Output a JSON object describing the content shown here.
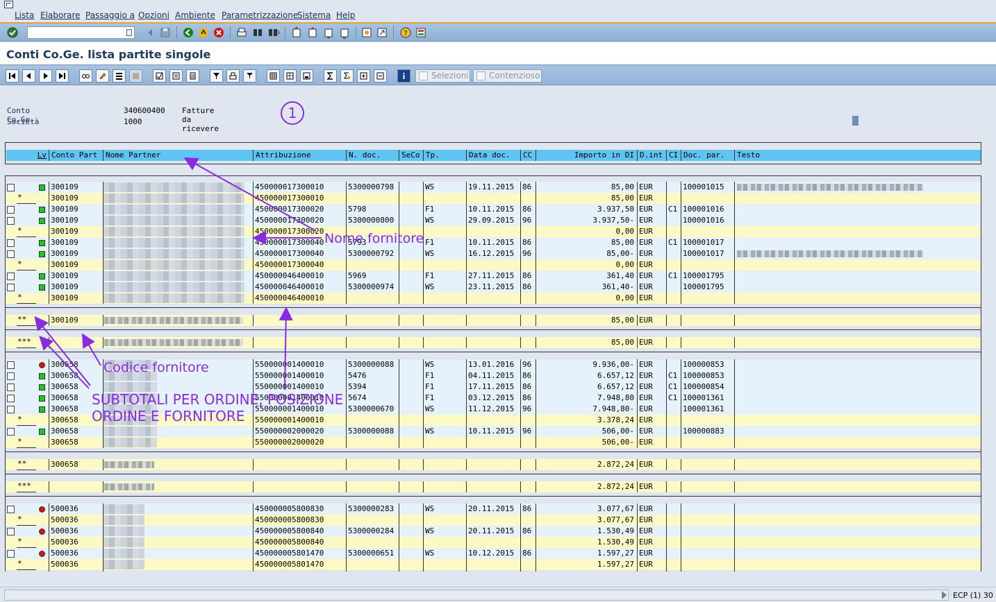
{
  "menu": [
    "Lista",
    "Elaborare",
    "Passaggio a",
    "Opzioni",
    "Ambiente",
    "Parametrizzazione",
    "Sistema",
    "Help"
  ],
  "command_field": "",
  "screen_title": "Conti Co.Ge. lista partite singole",
  "app_buttons": {
    "selezioni": "Selezioni",
    "contenzioso": "Contenzioso"
  },
  "header": {
    "conto_label": "Conto Co.Ge.",
    "conto_value": "340600400",
    "conto_desc": "Fatture da ricevere",
    "societa_label": "Società",
    "societa_value": "1000"
  },
  "marker": "1",
  "columns": [
    "Lv",
    "Conto Part",
    "Nome Partner",
    "Attribuzione",
    "N. doc.",
    "SeCo",
    "Tp.",
    "Data doc.",
    "CC",
    "Importo in DI",
    "D.int",
    "CI",
    "Doc. par.",
    "Testo"
  ],
  "rows": [
    {
      "cb": true,
      "lv": "",
      "led": "green",
      "conto": "300109",
      "partner": "",
      "attr": "450000017300010",
      "ndoc": "5300000798",
      "tp": "WS",
      "data": "19.11.2015",
      "cc": "86",
      "imp": "85,00",
      "div": "EUR",
      "ci": "",
      "docpar": "100001015",
      "testo": "",
      "kind": "w"
    },
    {
      "cb": false,
      "lv": "*",
      "led": "",
      "conto": "300109",
      "partner": "",
      "attr": "450000017300010",
      "ndoc": "",
      "tp": "",
      "data": "",
      "cc": "",
      "imp": "85,00",
      "div": "EUR",
      "ci": "",
      "docpar": "",
      "testo": "",
      "kind": "y"
    },
    {
      "cb": true,
      "lv": "",
      "led": "green",
      "conto": "300109",
      "partner": "",
      "attr": "450000017300020",
      "ndoc": "5798",
      "tp": "F1",
      "data": "10.11.2015",
      "cc": "86",
      "imp": "3.937,50",
      "div": "EUR",
      "ci": "C1",
      "docpar": "100001016",
      "testo": "",
      "kind": "w"
    },
    {
      "cb": true,
      "lv": "",
      "led": "green",
      "conto": "300109",
      "partner": "",
      "attr": "450000017300020",
      "ndoc": "5300000800",
      "tp": "WS",
      "data": "29.09.2015",
      "cc": "96",
      "imp": "3.937,50-",
      "div": "EUR",
      "ci": "",
      "docpar": "100001016",
      "testo": "",
      "kind": "w"
    },
    {
      "cb": false,
      "lv": "*",
      "led": "",
      "conto": "300109",
      "partner": "",
      "attr": "450000017300020",
      "ndoc": "",
      "tp": "",
      "data": "",
      "cc": "",
      "imp": "0,00",
      "div": "EUR",
      "ci": "",
      "docpar": "",
      "testo": "",
      "kind": "y"
    },
    {
      "cb": true,
      "lv": "",
      "led": "green",
      "conto": "300109",
      "partner": "",
      "attr": "450000017300040",
      "ndoc": "5793",
      "tp": "F1",
      "data": "10.11.2015",
      "cc": "86",
      "imp": "85,00",
      "div": "EUR",
      "ci": "C1",
      "docpar": "100001017",
      "testo": "",
      "kind": "w"
    },
    {
      "cb": true,
      "lv": "",
      "led": "green",
      "conto": "300109",
      "partner": "",
      "attr": "450000017300040",
      "ndoc": "5300000792",
      "tp": "WS",
      "data": "16.12.2015",
      "cc": "96",
      "imp": "85,00-",
      "div": "EUR",
      "ci": "",
      "docpar": "100001017",
      "testo": "",
      "kind": "w"
    },
    {
      "cb": false,
      "lv": "*",
      "led": "",
      "conto": "300109",
      "partner": "",
      "attr": "450000017300040",
      "ndoc": "",
      "tp": "",
      "data": "",
      "cc": "",
      "imp": "0,00",
      "div": "EUR",
      "ci": "",
      "docpar": "",
      "testo": "",
      "kind": "y"
    },
    {
      "cb": true,
      "lv": "",
      "led": "green",
      "conto": "300109",
      "partner": "",
      "attr": "450000046400010",
      "ndoc": "5969",
      "tp": "F1",
      "data": "27.11.2015",
      "cc": "86",
      "imp": "361,40",
      "div": "EUR",
      "ci": "C1",
      "docpar": "100001795",
      "testo": "",
      "kind": "w"
    },
    {
      "cb": true,
      "lv": "",
      "led": "green",
      "conto": "300109",
      "partner": "",
      "attr": "450000046400010",
      "ndoc": "5300000974",
      "tp": "WS",
      "data": "23.11.2015",
      "cc": "86",
      "imp": "361,40-",
      "div": "EUR",
      "ci": "",
      "docpar": "100001795",
      "testo": "",
      "kind": "w"
    },
    {
      "cb": false,
      "lv": "*",
      "led": "",
      "conto": "300109",
      "partner": "",
      "attr": "450000046400010",
      "ndoc": "",
      "tp": "",
      "data": "",
      "cc": "",
      "imp": "0,00",
      "div": "EUR",
      "ci": "",
      "docpar": "",
      "testo": "",
      "kind": "y"
    },
    {
      "kind": "gap"
    },
    {
      "cb": false,
      "lv": "**",
      "led": "",
      "conto": "300109",
      "partner": "",
      "attr": "",
      "ndoc": "",
      "tp": "",
      "data": "",
      "cc": "",
      "imp": "85,00",
      "div": "EUR",
      "ci": "",
      "docpar": "",
      "testo": "",
      "kind": "y"
    },
    {
      "kind": "gap"
    },
    {
      "cb": false,
      "lv": "***",
      "led": "",
      "conto": "",
      "partner": "",
      "attr": "",
      "ndoc": "",
      "tp": "",
      "data": "",
      "cc": "",
      "imp": "85,00",
      "div": "EUR",
      "ci": "",
      "docpar": "",
      "testo": "",
      "kind": "y"
    },
    {
      "kind": "gap"
    },
    {
      "cb": true,
      "lv": "",
      "led": "red",
      "conto": "300658",
      "partner": "",
      "attr": "550000001400010",
      "ndoc": "5300000088",
      "tp": "WS",
      "data": "13.01.2016",
      "cc": "96",
      "imp": "9.936,00-",
      "div": "EUR",
      "ci": "",
      "docpar": "100000853",
      "testo": "",
      "kind": "w"
    },
    {
      "cb": true,
      "lv": "",
      "led": "green",
      "conto": "300658",
      "partner": "",
      "attr": "550000001400010",
      "ndoc": "5476",
      "tp": "F1",
      "data": "04.11.2015",
      "cc": "86",
      "imp": "6.657,12",
      "div": "EUR",
      "ci": "C1",
      "docpar": "100000853",
      "testo": "",
      "kind": "w"
    },
    {
      "cb": true,
      "lv": "",
      "led": "green",
      "conto": "300658",
      "partner": "",
      "attr": "550000001400010",
      "ndoc": "5394",
      "tp": "F1",
      "data": "17.11.2015",
      "cc": "86",
      "imp": "6.657,12",
      "div": "EUR",
      "ci": "C1",
      "docpar": "100000854",
      "testo": "",
      "kind": "w"
    },
    {
      "cb": true,
      "lv": "",
      "led": "green",
      "conto": "300658",
      "partner": "",
      "attr": "550000001400010",
      "ndoc": "5674",
      "tp": "F1",
      "data": "03.12.2015",
      "cc": "86",
      "imp": "7.948,80",
      "div": "EUR",
      "ci": "C1",
      "docpar": "100001361",
      "testo": "",
      "kind": "w"
    },
    {
      "cb": true,
      "lv": "",
      "led": "green",
      "conto": "300658",
      "partner": "",
      "attr": "550000001400010",
      "ndoc": "5300000670",
      "tp": "WS",
      "data": "11.12.2015",
      "cc": "96",
      "imp": "7.948,80-",
      "div": "EUR",
      "ci": "",
      "docpar": "100001361",
      "testo": "",
      "kind": "w"
    },
    {
      "cb": false,
      "lv": "*",
      "led": "",
      "conto": "300658",
      "partner": "",
      "attr": "550000001400010",
      "ndoc": "",
      "tp": "",
      "data": "",
      "cc": "",
      "imp": "3.378,24",
      "div": "EUR",
      "ci": "",
      "docpar": "",
      "testo": "",
      "kind": "y"
    },
    {
      "cb": true,
      "lv": "",
      "led": "green",
      "conto": "300658",
      "partner": "",
      "attr": "550000002000020",
      "ndoc": "5300000088",
      "tp": "WS",
      "data": "10.11.2015",
      "cc": "96",
      "imp": "506,00-",
      "div": "EUR",
      "ci": "",
      "docpar": "100000883",
      "testo": "",
      "kind": "w"
    },
    {
      "cb": false,
      "lv": "*",
      "led": "",
      "conto": "300658",
      "partner": "",
      "attr": "550000002000020",
      "ndoc": "",
      "tp": "",
      "data": "",
      "cc": "",
      "imp": "506,00-",
      "div": "EUR",
      "ci": "",
      "docpar": "",
      "testo": "",
      "kind": "y"
    },
    {
      "kind": "gap"
    },
    {
      "cb": false,
      "lv": "**",
      "led": "",
      "conto": "300658",
      "partner": "",
      "attr": "",
      "ndoc": "",
      "tp": "",
      "data": "",
      "cc": "",
      "imp": "2.872,24",
      "div": "EUR",
      "ci": "",
      "docpar": "",
      "testo": "",
      "kind": "y"
    },
    {
      "kind": "gap"
    },
    {
      "cb": false,
      "lv": "***",
      "led": "",
      "conto": "",
      "partner": "",
      "attr": "",
      "ndoc": "",
      "tp": "",
      "data": "",
      "cc": "",
      "imp": "2.872,24",
      "div": "EUR",
      "ci": "",
      "docpar": "",
      "testo": "",
      "kind": "y"
    },
    {
      "kind": "gap"
    },
    {
      "cb": true,
      "lv": "",
      "led": "red",
      "conto": "500036",
      "partner": "",
      "attr": "450000005800830",
      "ndoc": "5300000283",
      "tp": "WS",
      "data": "20.11.2015",
      "cc": "86",
      "imp": "3.077,67",
      "div": "EUR",
      "ci": "",
      "docpar": "",
      "testo": "",
      "kind": "w"
    },
    {
      "cb": false,
      "lv": "*",
      "led": "",
      "conto": "500036",
      "partner": "",
      "attr": "450000005800830",
      "ndoc": "",
      "tp": "",
      "data": "",
      "cc": "",
      "imp": "3.077,67",
      "div": "EUR",
      "ci": "",
      "docpar": "",
      "testo": "",
      "kind": "y"
    },
    {
      "cb": true,
      "lv": "",
      "led": "red",
      "conto": "500036",
      "partner": "",
      "attr": "450000005800840",
      "ndoc": "5300000284",
      "tp": "WS",
      "data": "20.11.2015",
      "cc": "86",
      "imp": "1.530,49",
      "div": "EUR",
      "ci": "",
      "docpar": "",
      "testo": "",
      "kind": "w"
    },
    {
      "cb": false,
      "lv": "*",
      "led": "",
      "conto": "500036",
      "partner": "",
      "attr": "450000005800840",
      "ndoc": "",
      "tp": "",
      "data": "",
      "cc": "",
      "imp": "1.530,49",
      "div": "EUR",
      "ci": "",
      "docpar": "",
      "testo": "",
      "kind": "y"
    },
    {
      "cb": true,
      "lv": "",
      "led": "red",
      "conto": "500036",
      "partner": "",
      "attr": "450000005801470",
      "ndoc": "5300000651",
      "tp": "WS",
      "data": "10.12.2015",
      "cc": "86",
      "imp": "1.597,27",
      "div": "EUR",
      "ci": "",
      "docpar": "",
      "testo": "",
      "kind": "w"
    },
    {
      "cb": false,
      "lv": "*",
      "led": "",
      "conto": "500036",
      "partner": "",
      "attr": "450000005801470",
      "ndoc": "",
      "tp": "",
      "data": "",
      "cc": "",
      "imp": "1.597,27",
      "div": "EUR",
      "ci": "",
      "docpar": "",
      "testo": "",
      "kind": "y"
    }
  ],
  "annotations": {
    "nome_fornitore": "Nome fornitore",
    "codice_fornitore": "Codice fornitore",
    "subtotali_1": "SUBTOTALI PER ORDINE, POSIZIONE",
    "subtotali_2": "ORDINE E FORNITORE"
  },
  "status": {
    "system": "ECP (1) 30"
  },
  "colors": {
    "accent_annotation": "#8a2be2",
    "header_band": "#5fc4f2",
    "row_yellow": "#fdf9c4",
    "row_white": "#e5f2fb"
  }
}
